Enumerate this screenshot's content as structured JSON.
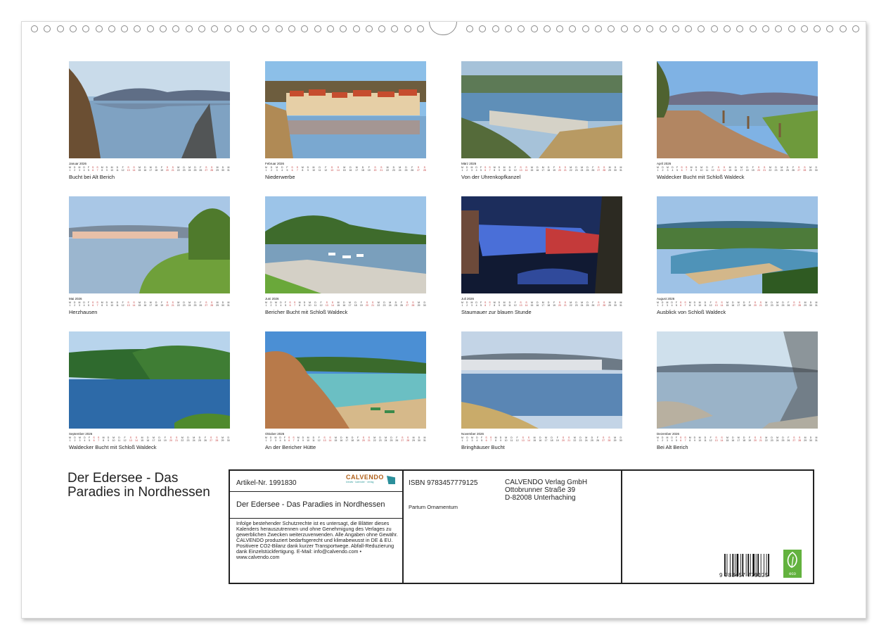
{
  "calendar": {
    "year": "2026",
    "months": [
      {
        "name": "Januar",
        "days": 31,
        "caption": "Bucht bei Alt Berich",
        "scene": "lake-reflection"
      },
      {
        "name": "Februar",
        "days": 28,
        "caption": "Niederwerbe",
        "scene": "village"
      },
      {
        "name": "März",
        "days": 31,
        "caption": "Von der Uhrenkopfkanzel",
        "scene": "dam-aerial"
      },
      {
        "name": "April",
        "days": 30,
        "caption": "Waldecker Bucht mit Schloß Waldeck",
        "scene": "path"
      },
      {
        "name": "Mai",
        "days": 31,
        "caption": "Herzhausen",
        "scene": "lake-town"
      },
      {
        "name": "Juni",
        "days": 30,
        "caption": "Bericher Bucht mit Schloß Waldeck",
        "scene": "harbor"
      },
      {
        "name": "Juli",
        "days": 31,
        "caption": "Staumauer zur blauen Stunde",
        "scene": "dam-night"
      },
      {
        "name": "August",
        "days": 31,
        "caption": "Ausblick von Schloß Waldeck",
        "scene": "valley"
      },
      {
        "name": "September",
        "days": 30,
        "caption": "Waldecker Bucht mit Schloß Waldeck",
        "scene": "forest-lake"
      },
      {
        "name": "Oktober",
        "days": 31,
        "caption": "An der Bericher Hütte",
        "scene": "rocks"
      },
      {
        "name": "November",
        "days": 30,
        "caption": "Bringhäuser Bucht",
        "scene": "shore-town"
      },
      {
        "name": "Dezember",
        "days": 31,
        "caption": "Bei Alt Berich",
        "scene": "winter"
      }
    ]
  },
  "cover": {
    "title": "Der Edersee - Das Paradies in Nordhessen"
  },
  "info": {
    "article_label": "Artikel-Nr. 1991830",
    "logo_text": "CALVENDO",
    "logo_sub": "kreativ · kalender · verlag",
    "title": "Der Edersee - Das Paradies in Nordhessen",
    "legal": "Infolge bestehender Schutzrechte ist es untersagt, die Blätter dieses Kalenders herauszutrennen und ohne Genehmigung des Verlages zu gewerblichen Zwecken weiterzuverwenden. Alle Angaben ohne Gewähr. CALVENDO produziert bedarfsgerecht und klimabewusst in DE & EU. Positivere CO2-Bilanz dank kurzer Transportwege. Abfall-Reduzierung dank Einzelstückfertigung. E-Mail: info@calvendo.com • www.calvendo.com",
    "isbn": "ISBN 9783457779125",
    "publisher_line1": "CALVENDO Verlag GmbH",
    "publisher_line2": "Ottobrunner Straße 39",
    "publisher_line3": "D-82008 Unterhaching",
    "partum": "Partum Ornamentum",
    "barcode_digits": "9 783457 779125",
    "eco_label": "eco"
  },
  "colors": {
    "weekend": "#c03030",
    "sheet_border": "#d8d8d8",
    "eco_green": "#63b23e"
  }
}
